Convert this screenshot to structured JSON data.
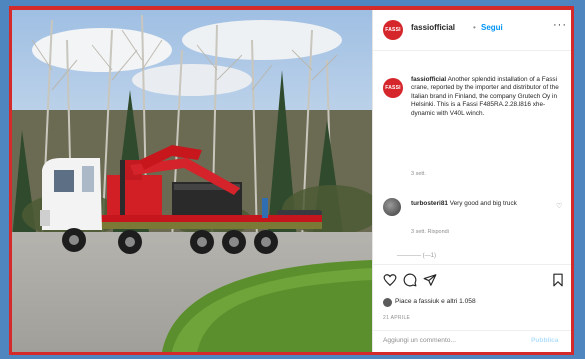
{
  "post": {
    "username": "fassiofficial",
    "separator": "•",
    "follow_label": "Segui",
    "more_label": "···",
    "logo_text": "FASSI",
    "caption": {
      "username": "fassiofficial",
      "text": "Another splendid installation of a Fassi crane, reported by the importer and distributor of the Italian brand in Finland, the company Grutech Oy in Helsinki. This is a Fassi F485RA.2.28.l816 xhe-dynamic with V40L winch.",
      "time": "3 sett."
    },
    "comment": {
      "username": "turbosteri81",
      "text": "Very good and big truck",
      "meta": "3 sett.   Rispondi",
      "partial_text": "———— (—1)"
    },
    "icons": {
      "like": "heart-icon",
      "comment": "comment-icon",
      "share": "share-icon",
      "save": "bookmark-icon"
    },
    "likes": {
      "text": "Piace a fassiuk e altri 1.058"
    },
    "date": "21 APRILE",
    "add_comment_placeholder": "Aggiungi un commento...",
    "publish_label": "Pubblica"
  },
  "colors": {
    "frame_red": "#d42a2a",
    "background_blue": "#4f86c0",
    "follow_blue": "#0095f6",
    "brand_red": "#d5262b"
  }
}
